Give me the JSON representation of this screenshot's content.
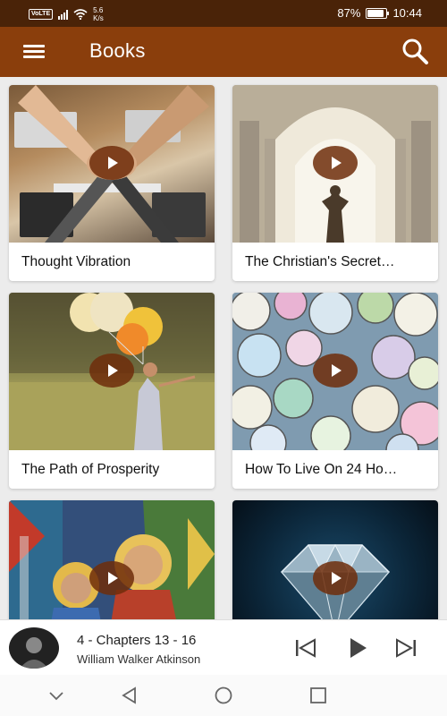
{
  "status_bar": {
    "network_badge": "VoLTE",
    "speed_value": "5.6",
    "speed_unit": "K/s",
    "battery_percent": "87%",
    "battery_level": 0.87,
    "time": "10:44"
  },
  "app_bar": {
    "title": "Books",
    "menu_icon": "hamburger-menu-icon",
    "search_icon": "search-icon"
  },
  "books": [
    {
      "title": "Thought Vibration",
      "play_icon": "play-icon"
    },
    {
      "title": "The Christian's Secret…",
      "play_icon": "play-icon"
    },
    {
      "title": "The Path of Prosperity",
      "play_icon": "play-icon"
    },
    {
      "title": "How To Live On 24 Ho…",
      "play_icon": "play-icon"
    },
    {
      "title": "",
      "play_icon": "play-icon"
    },
    {
      "title": "",
      "play_icon": "play-icon"
    }
  ],
  "now_playing": {
    "track": "4 - Chapters 13 - 16",
    "author": "William Walker Atkinson",
    "prev_icon": "skip-previous-icon",
    "play_icon": "play-icon",
    "next_icon": "skip-next-icon"
  },
  "nav_bar": {
    "down_icon": "chevron-down-icon",
    "back_icon": "back-triangle-icon",
    "home_icon": "home-circle-icon",
    "recents_icon": "recents-square-icon"
  },
  "colors": {
    "status_bar": "#4a2308",
    "app_bar": "#8a3e0c",
    "play_button": "#6e2d0a"
  }
}
